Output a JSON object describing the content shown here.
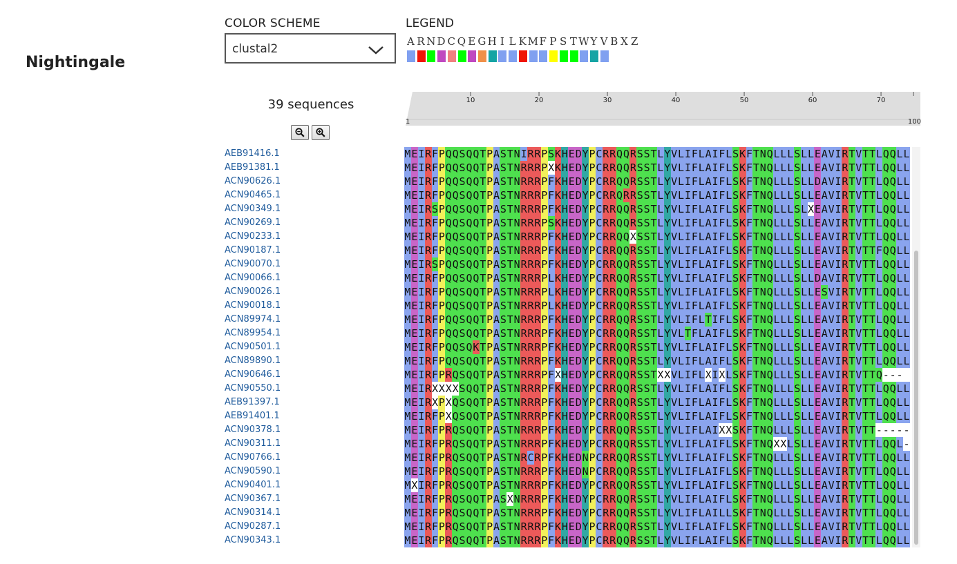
{
  "app": {
    "title": "Nightingale"
  },
  "color_scheme": {
    "label": "COLOR SCHEME",
    "value": "clustal2",
    "icon": "chevron-down-icon"
  },
  "legend": {
    "label": "LEGEND",
    "letters": [
      "A",
      "R",
      "N",
      "D",
      "C",
      "Q",
      "E",
      "G",
      "H",
      "I",
      "L",
      "K",
      "M",
      "F",
      "P",
      "S",
      "T",
      "W",
      "Y",
      "V",
      "B",
      "X",
      "Z"
    ],
    "colors": [
      "#80a0f0",
      "#f01505",
      "#00ff00",
      "#c048c0",
      "#f08080",
      "#00ff00",
      "#c048c0",
      "#f09048",
      "#15a4a4",
      "#80a0f0",
      "#80a0f0",
      "#f01505",
      "#80a0f0",
      "#80a0f0",
      "#ffff00",
      "#00ff00",
      "#00ff00",
      "#80a0f0",
      "#15a4a4",
      "#80a0f0",
      "#ffffff",
      "#ffffff",
      "#ffffff"
    ]
  },
  "sequences_count": "39 sequences",
  "zoom": {
    "out_icon": "zoom-out-icon",
    "in_icon": "zoom-in-icon"
  },
  "ruler": {
    "start": "1",
    "end": "100",
    "ticks": [
      "10",
      "20",
      "30",
      "40",
      "50",
      "60",
      "70"
    ]
  },
  "residue_colors": {
    "A": "#8aa4ee",
    "V": "#8aa4ee",
    "I": "#8aa4ee",
    "L": "#8aa4ee",
    "M": "#8aa4ee",
    "F": "#8aa4ee",
    "W": "#8aa4ee",
    "C": "#8aa4ee",
    "R": "#ec5a5a",
    "K": "#ec5a5a",
    "S": "#4ee04e",
    "T": "#4ee04e",
    "N": "#4ee04e",
    "Q": "#4ee04e",
    "D": "#c866c8",
    "E": "#c866c8",
    "G": "#efa060",
    "P": "#f2f05a",
    "H": "#32a8a4",
    "Y": "#32a8a4",
    "X": "#ffffff",
    "-": "#ffffff"
  },
  "sequences": [
    {
      "id": "AEB91416.1",
      "seq": "MEIRFPQQSQQTPASTNIRRPSKHEDYPCRRQQRSSTLYVLIFLAIFLSKFTNQLLLSLLEAVIRTVTTLQQLL"
    },
    {
      "id": "AEB91381.1",
      "seq": "MEIRFPQQSQQTPASTNRRRPXKHEDYPCRRQQRSSTLYVLIFLAIFLSKFTNQLLLSLLEAVIRTVTTLQQLL"
    },
    {
      "id": "ACN90626.1",
      "seq": "MEIRFPQQSQQTPASTNRRRPFKHEDYPCRRQQRSSTLYVLIFLAIFLSKFTNQLLLSLLDAVIRTVTTLQQLL"
    },
    {
      "id": "ACN90465.1",
      "seq": "MEIRFPQQSQQTPASTNRRRPFKHEDYPCRRQRRSSTLYVLIFLAIFLSKFTNQLLLSLLEAVIRTVTTLQQLL"
    },
    {
      "id": "ACN90349.1",
      "seq": "MEIRSPQQSQQTPASTNRRRPFKHEDYPCRRQQRSSTLYVLIFLAIFLSKFTNQLLLSLXEAVIRTVTTLQQLL"
    },
    {
      "id": "ACN90269.1",
      "seq": "MEIRFPQQSQQTPASTNRRRPSKHEDYPCRRQQRSSTLYVLIFLAIFLSKFTNQLLLSLLEAVIRTVTTLQQLL"
    },
    {
      "id": "ACN90233.1",
      "seq": "MEIRFPQQSQQTPASTNRRRPFKHEDYPCRRQQXSSTLYVLIFLAIFLSKFTNQLLLSLLEAVIRTVTTLQQLL"
    },
    {
      "id": "ACN90187.1",
      "seq": "MEIRFPQQSQQTPASTNRRRPFKHEDYPCRRQQRSSTLYVLIFLAIFLSKFTNQLLLSLLEAVIRTVTTFQQLL"
    },
    {
      "id": "ACN90070.1",
      "seq": "MEIRSPQQSQQTPASTNRRRPFKHEDYPCRRQQRSSTLYVLIFLAIFLSKFTNQLLLSLLEAVIRTVTTLQQLL"
    },
    {
      "id": "ACN90066.1",
      "seq": "MEIRFPQQSQQTPASTNRRRPLKHEDYPCRRQQRSSTLYVLIFLAIFLSKFTNQLLLSLLDAVIRTVTTLQQLL"
    },
    {
      "id": "ACN90026.1",
      "seq": "MEIRFPQQSQQTPASTNRRRPLKHEDYPCRRQQRSSTLYVLIFLAIFLSKFTNQLLLSLLESVIRTVTTLQQLL"
    },
    {
      "id": "ACN90018.1",
      "seq": "MEIRFPQQSQQTPASTNRRRPLKHEDYPCRRQQRSSTLYVLIFLAIFLSKFTNQLLLSLLEAVIRTVTTLQQLL"
    },
    {
      "id": "ACN89974.1",
      "seq": "MEIRFPQQSQQTPASTNRRRPFKHEDYPCRRQQRSSTLYVLIFLTIFLSKFTNQLLLSLLEAVIRTVTTLQQLL"
    },
    {
      "id": "ACN89954.1",
      "seq": "MEIRFPQQSQQTPASTNRRRPFKHEDYPCRRQQRSSTLYVLTFLAIFLSKFTNQLLLSLLEAVIRTVTTLQQLL"
    },
    {
      "id": "ACN90501.1",
      "seq": "MEIRFPQQSQKTPASTNRRRPFKHEDYPCRRQQRSSTLYVLIFLAIFLSKFTNQLLLSLLEAVIRTVTTLQQLL"
    },
    {
      "id": "ACN89890.1",
      "seq": "MEIRFPQQSQQTPASTNRRRPFKHEDYPCRRQQRSSTLYVLIFLAIFLSKFTNQLLLSLLEAVIRTVTTLQQLL"
    },
    {
      "id": "ACN90646.1",
      "seq": "MEIRFPRQSQQTPASTNRRRPFXHEDYPCRRQQRSSTXXVLIFLXIXLSKFTNQLLLSLLEAVIRTVTTQ---"
    },
    {
      "id": "ACN90550.1",
      "seq": "MEIRXXXXSQQTPASTNRRRPFKHEDYPCRRQQRSSTLYVLIFLAIFLSKFTNQLLLSLLEAVIRTVTTLQQLL"
    },
    {
      "id": "AEB91397.1",
      "seq": "MEIRXPXQSQQTPASTNRRRPFKHEDYPCRRQQRSSTLYVLIFLAIFLSKFTNQLLLSLLEAVIRTVTTLQQLL"
    },
    {
      "id": "AEB91401.1",
      "seq": "MEIRFPXQSQQTPASTNRRRPFKHEDYPCRRQQRSSTLYVLIFLAIFLSKFTNQLLLSLLEAVIRTVTTLQQLL"
    },
    {
      "id": "ACN90378.1",
      "seq": "MEIRFPRQSQQTPASTNRRRPFKHEDYPCRRQQRSSTLYVLIFLAIXXSKFTNQLLLSLLEAVIRTVTT-----"
    },
    {
      "id": "ACN90311.1",
      "seq": "MEIRFPRQSQQTPASTNRRRPFKHEDYPCRRQQRSSTLYVLIFLAIFLSKFTNQXXLSLLEAVIRTVTTLQQL-"
    },
    {
      "id": "ACN90766.1",
      "seq": "MEIRFPRQSQQTPASTNRCRPFKHEDNPCRRQQRSSTLYVLIFLAIFLSKFTNQLLLSLLEAVIRTVTTLQQLL"
    },
    {
      "id": "ACN90590.1",
      "seq": "MEIRFPRQSQQTPASTNRRRPFKHEDNPCRRQQRSSTLYVLIFLAIFLSKFTNQLLLSLLEAVIRTVTTLQQLL"
    },
    {
      "id": "ACN90401.1",
      "seq": "MXIRFPRQSQQTPASTNRRRPFKHEDYPCRRQQRSSTLYVLIFLAIFLSKFTNQLLLSLLEAVIRTVTTLQQLL"
    },
    {
      "id": "ACN90367.1",
      "seq": "MEIRFPRQSQQTPASXNRRRPFKHEDYPCRRQQRSSTLYVLIFLAIFLSKFTNQLLLSLLEAVIRTVTTLQQLL"
    },
    {
      "id": "ACN90314.1",
      "seq": "MEIRFPRQSQQTPASTNRRRPFKHEDYPCRRQQRSSTLYVLIFLAILLSKFTNQLLLSLLEAVIRTVTTLQQLL"
    },
    {
      "id": "ACN90287.1",
      "seq": "MEIRFPRQSQQTPASTNRRRPFKHEDYPCRRQQRSSTLYVLIFLAIFLSKFTNQLLLSLLEAVIRTVTTLQQLL"
    },
    {
      "id": "ACN90343.1",
      "seq": "MEIRFPRQSQQTPASTNRRRPFKHEDYPCRRQQRSSTLYVLIFLAIFLSKFTNQLLLSLLEAVIRTVTTLQQLL"
    }
  ]
}
